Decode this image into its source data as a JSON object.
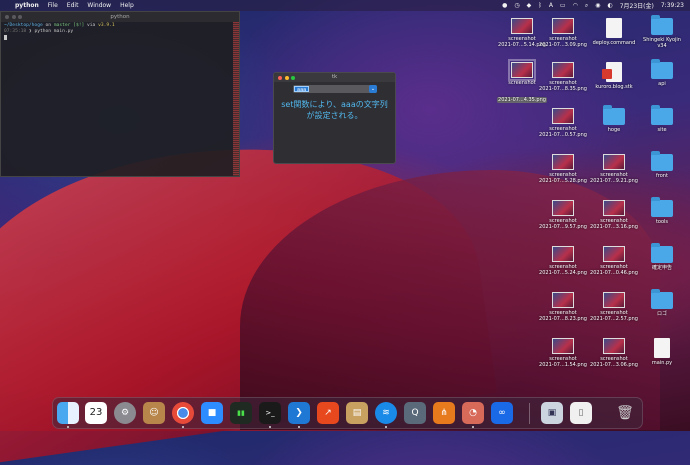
{
  "menubar": {
    "app": "python",
    "items": [
      "File",
      "Edit",
      "Window",
      "Help"
    ],
    "status_date": "7月23日(金)",
    "status_time": "7:39:23",
    "status_letter": "A"
  },
  "terminal": {
    "title": "python",
    "line1": {
      "path": "~/Desktop/hoge",
      "on": " on ",
      "branch": " master [$!]",
      "via": " via ",
      "ver": " v3.9.1"
    },
    "line2": {
      "time": "07:35:18",
      "cmd": " ❯ python main.py"
    }
  },
  "tk_window": {
    "title": "tk",
    "combo_value": "aaa",
    "message": "set関数により、aaaの文字列が設定される。"
  },
  "desktop": {
    "icons": [
      {
        "label1": "screenshot",
        "label2": "2021-07...5.14.png",
        "kind": "thumb"
      },
      {
        "label1": "screenshot",
        "label2": "2021-07...3.09.png",
        "kind": "thumb"
      },
      {
        "label1": "deploy.command",
        "label2": "",
        "kind": "doc"
      },
      {
        "label1": "Shingeki Kyojin",
        "label2": "v34",
        "kind": "folder"
      },
      {
        "label1": "screenshot",
        "label2": "2021-07...4.35.png",
        "kind": "thumb"
      },
      {
        "label1": "screenshot",
        "label2": "2021-07...8.35.png",
        "kind": "thumb"
      },
      {
        "label1": "kuroro.blog.stk",
        "label2": "",
        "kind": "docred"
      },
      {
        "label1": "api",
        "label2": "",
        "kind": "folder"
      },
      {
        "label1": "screenshot",
        "label2": "2021-07...0.57.png",
        "kind": "thumb"
      },
      {
        "label1": "hoge",
        "label2": "",
        "kind": "folder"
      },
      {
        "label1": "site",
        "label2": "",
        "kind": "folder"
      },
      {
        "label1": "screenshot",
        "label2": "2021-07...5.28.png",
        "kind": "thumb"
      },
      {
        "label1": "screenshot",
        "label2": "2021-07...9.21.png",
        "kind": "thumb"
      },
      {
        "label1": "front",
        "label2": "",
        "kind": "folder"
      },
      {
        "label1": "screenshot",
        "label2": "2021-07...9.57.png",
        "kind": "thumb"
      },
      {
        "label1": "screenshot",
        "label2": "2021-07...3.16.png",
        "kind": "thumb"
      },
      {
        "label1": "tools",
        "label2": "",
        "kind": "folder"
      },
      {
        "label1": "screenshot",
        "label2": "2021-07...5.24.png",
        "kind": "thumb"
      },
      {
        "label1": "screenshot",
        "label2": "2021-07...0.46.png",
        "kind": "thumb"
      },
      {
        "label1": "確定申告",
        "label2": "",
        "kind": "folder"
      },
      {
        "label1": "screenshot",
        "label2": "2021-07...8.23.png",
        "kind": "thumb"
      },
      {
        "label1": "screenshot",
        "label2": "2021-07...2.57.png",
        "kind": "thumb"
      },
      {
        "label1": "ロゴ",
        "label2": "",
        "kind": "folder"
      },
      {
        "label1": "screenshot",
        "label2": "2021-07...1.54.png",
        "kind": "thumb"
      },
      {
        "label1": "screenshot",
        "label2": "2021-07...3.06.png",
        "kind": "thumb"
      },
      {
        "label1": "main.py",
        "label2": "",
        "kind": "doc"
      }
    ]
  },
  "dock": {
    "calendar_day": "23",
    "terminal_glyph": ">_"
  }
}
